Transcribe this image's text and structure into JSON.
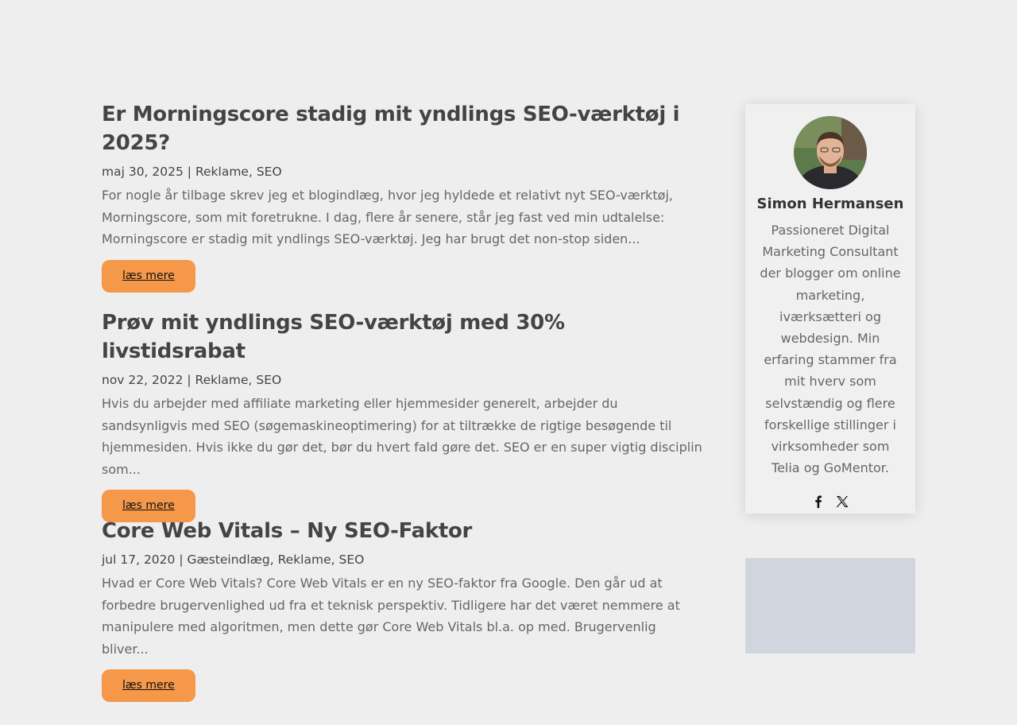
{
  "posts": [
    {
      "title": "Er Morningscore stadig mit yndlings SEO-værktøj i 2025?",
      "date": "maj 30, 2025",
      "categories": [
        "Reklame",
        "SEO"
      ],
      "excerpt": "For nogle år tilbage skrev jeg et blogindlæg, hvor jeg hyldede et relativt nyt SEO-værktøj, Morningscore, som mit foretrukne. I dag, flere år senere, står jeg fast ved min udtalelse: Morningscore er stadig mit yndlings SEO-værktøj. Jeg har brugt det non-stop siden...",
      "button": "læs mere"
    },
    {
      "title": "Prøv mit yndlings SEO-værktøj med 30% livstidsrabat",
      "date": "nov 22, 2022",
      "categories": [
        "Reklame",
        "SEO"
      ],
      "excerpt": "Hvis du arbejder med affiliate marketing eller hjemmesider generelt, arbejder du sandsynligvis med SEO (søgemaskineoptimering) for at tiltrække de rigtige besøgende til hjemmesiden. Hvis ikke du gør det, bør du hvert fald gøre det. SEO er en super vigtig disciplin som...",
      "button": "læs mere"
    },
    {
      "title": "Core Web Vitals – Ny SEO-Faktor",
      "date": "jul 17, 2020",
      "categories": [
        "Gæsteindlæg",
        "Reklame",
        "SEO"
      ],
      "excerpt": "Hvad er Core Web Vitals? Core Web Vitals er en ny SEO-faktor fra Google. Den går ud at forbedre brugervenlighed ud fra et teknisk perspektiv. Tidligere har det været nemmere at manipulere med algoritmen, men dette gør Core Web Vitals bl.a. op med. Brugervenlig bliver...",
      "button": "læs mere"
    }
  ],
  "author": {
    "name": "Simon Hermansen",
    "bio": "Passioneret Digital Marketing Consultant der blogger om online marketing, iværksætteri og webdesign. Min erfaring stammer fra mit hverv som selvstændig og flere forskellige stillinger i virksomheder som Telia og GoMentor.",
    "social": [
      "facebook-icon",
      "x-icon"
    ]
  },
  "colors": {
    "background": "#eeeeee",
    "button": "#f5984a",
    "title": "#444444",
    "ad_placeholder": "#d1d5dd"
  }
}
